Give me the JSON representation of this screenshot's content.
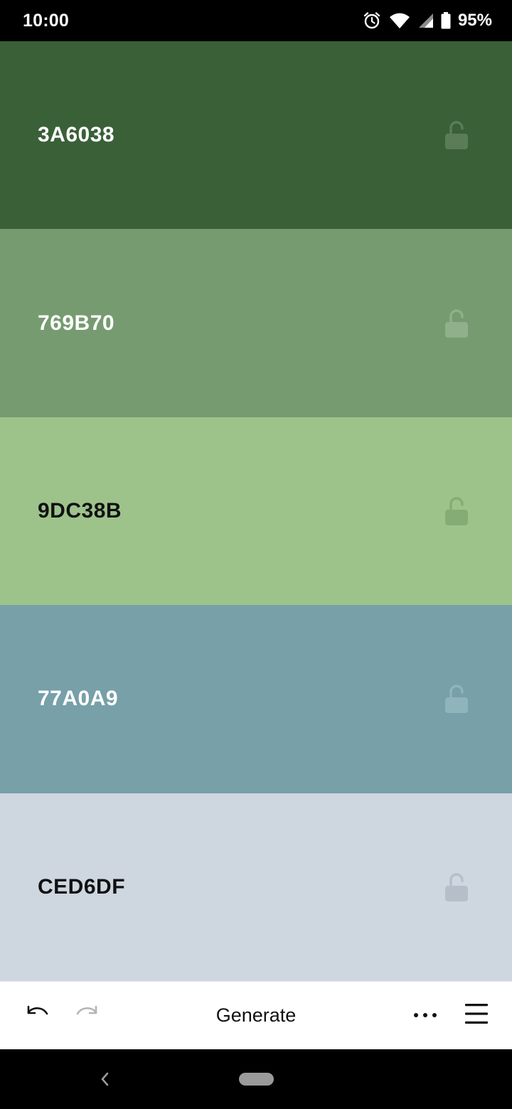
{
  "status_bar": {
    "time": "10:00",
    "battery_percent": "95%",
    "icons": [
      "alarm-icon",
      "wifi-icon",
      "cell-signal-icon",
      "battery-icon"
    ]
  },
  "swatches": [
    {
      "hex": "3A6038",
      "color": "#3A6038",
      "text_color": "#ffffff",
      "lock_color": "#5a7d57",
      "locked": false
    },
    {
      "hex": "769B70",
      "color": "#769B70",
      "text_color": "#ffffff",
      "lock_color": "#8fb08a",
      "locked": false
    },
    {
      "hex": "9DC38B",
      "color": "#9DC38B",
      "text_color": "#111111",
      "lock_color": "#86ac76",
      "locked": false
    },
    {
      "hex": "77A0A9",
      "color": "#77A0A9",
      "text_color": "#ffffff",
      "lock_color": "#90b4bb",
      "locked": false
    },
    {
      "hex": "CED6DF",
      "color": "#CED6DF",
      "text_color": "#111111",
      "lock_color": "#b6bfc9",
      "locked": false
    }
  ],
  "toolbar": {
    "undo_icon": "undo-icon",
    "redo_icon": "redo-icon",
    "generate_label": "Generate",
    "more_icon": "more-horizontal-icon",
    "menu_icon": "hamburger-menu-icon"
  },
  "nav_bar": {
    "back_icon": "nav-back-icon",
    "home_icon": "nav-home-pill-icon"
  }
}
